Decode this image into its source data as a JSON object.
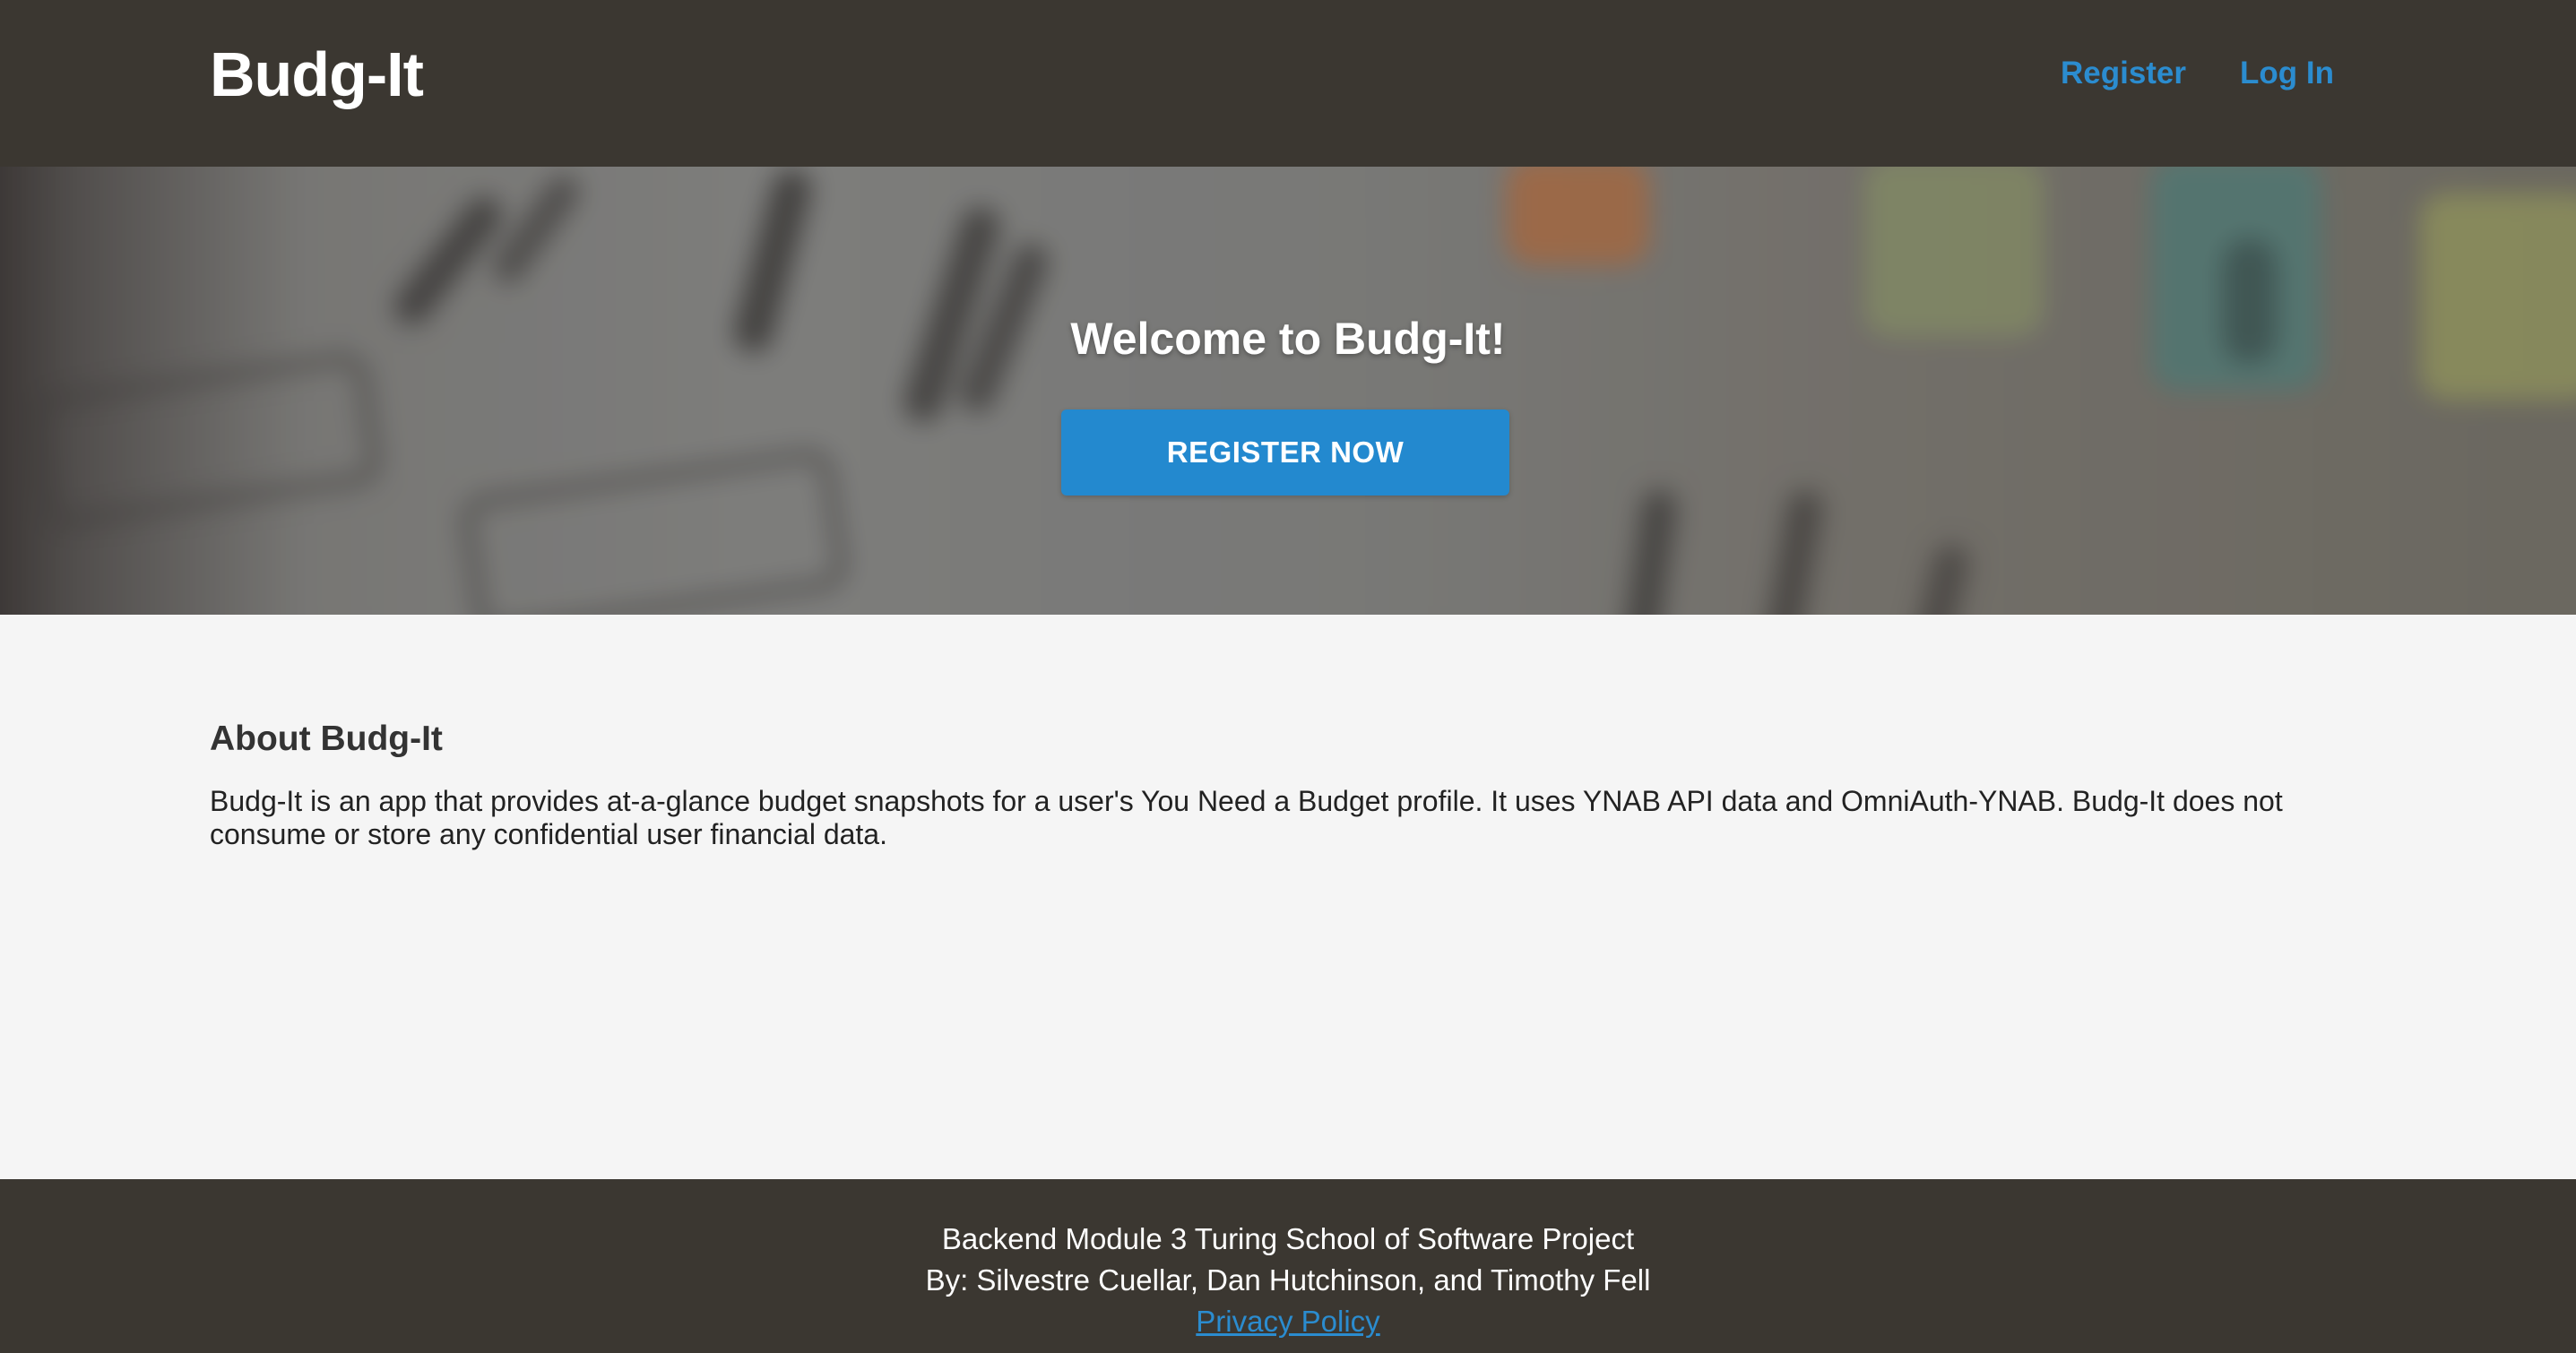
{
  "header": {
    "brand": "Budg-It",
    "nav": {
      "register_label": "Register",
      "login_label": "Log In"
    }
  },
  "hero": {
    "title": "Welcome to Budg-It!",
    "cta_label": "REGISTER NOW"
  },
  "about": {
    "heading": "About Budg-It",
    "body": "Budg-It is an app that provides at-a-glance budget snapshots for a user's You Need a Budget profile. It uses YNAB API data and OmniAuth-YNAB. Budg-It does not consume or store any confidential user financial data."
  },
  "footer": {
    "line1": "Backend Module 3 Turing School of Software Project",
    "line2": "By: Silvestre Cuellar, Dan Hutchinson, and Timothy Fell",
    "privacy_label": "Privacy Policy"
  },
  "colors": {
    "header_bg": "#3b3731",
    "accent": "#2389cf",
    "link": "#2b8ccf",
    "body_bg": "#f5f5f5"
  }
}
